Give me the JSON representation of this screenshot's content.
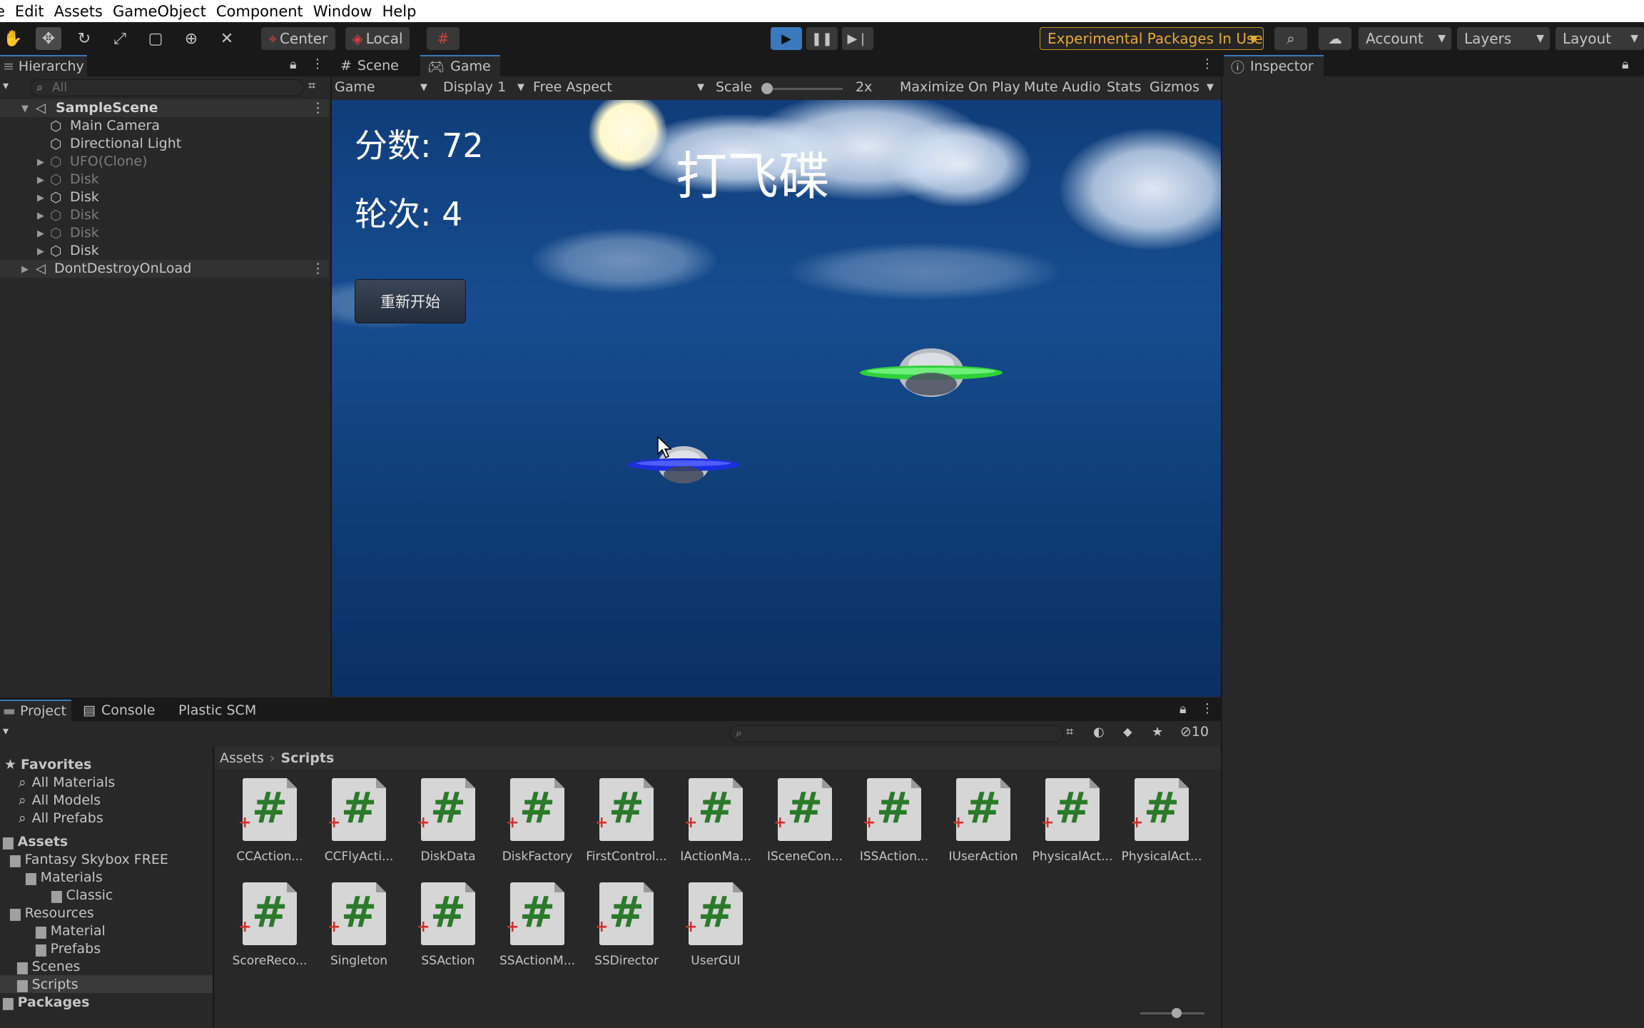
{
  "menu": [
    "e",
    "Edit",
    "Assets",
    "GameObject",
    "Component",
    "Window",
    "Help"
  ],
  "toolbar": {
    "pivot": "Center",
    "space": "Local",
    "experimental": "Experimental Packages In Use",
    "account": "Account",
    "layers": "Layers",
    "layout": "Layout"
  },
  "hierarchy": {
    "tab": "Hierarchy",
    "search_placeholder": "All",
    "scene": "SampleScene",
    "items": [
      {
        "label": "Main Camera",
        "active": true
      },
      {
        "label": "Directional Light",
        "active": true
      },
      {
        "label": "UFO(Clone)",
        "active": false
      },
      {
        "label": "Disk",
        "active": false
      },
      {
        "label": "Disk",
        "active": true
      },
      {
        "label": "Disk",
        "active": false
      },
      {
        "label": "Disk",
        "active": false
      },
      {
        "label": "Disk",
        "active": true
      }
    ],
    "dont_destroy": "DontDestroyOnLoad"
  },
  "view_tabs": {
    "scene": "Scene",
    "game": "Game"
  },
  "game_bar": {
    "mode": "Game",
    "display": "Display 1",
    "aspect": "Free Aspect",
    "scale_label": "Scale",
    "scale_value": "2x",
    "scale_fraction": 0.0,
    "maximize": "Maximize On Play",
    "mute": "Mute Audio",
    "stats": "Stats",
    "gizmos": "Gizmos"
  },
  "game": {
    "score": "分数: 72",
    "round": "轮次: 4",
    "title": "打飞碟",
    "restart": "重新开始"
  },
  "inspector": {
    "tab": "Inspector"
  },
  "bottom_tabs": {
    "project": "Project",
    "console": "Console",
    "plastic": "Plastic SCM"
  },
  "project": {
    "hidden_count": "10",
    "favorites": "Favorites",
    "fav_items": [
      "All Materials",
      "All Models",
      "All Prefabs"
    ],
    "assets": "Assets",
    "tree": [
      {
        "label": "Fantasy Skybox FREE",
        "depth": 1
      },
      {
        "label": "Materials",
        "depth": 2
      },
      {
        "label": "Classic",
        "depth": 3
      },
      {
        "label": "Resources",
        "depth": 1
      },
      {
        "label": "Material",
        "depth": 2
      },
      {
        "label": "Prefabs",
        "depth": 2
      },
      {
        "label": "Scenes",
        "depth": 1
      },
      {
        "label": "Scripts",
        "depth": 1
      }
    ],
    "packages": "Packages",
    "breadcrumb": {
      "root": "Assets",
      "current": "Scripts"
    },
    "scripts": [
      "CCAction...",
      "CCFlyActi...",
      "DiskData",
      "DiskFactory",
      "FirstControl...",
      "IActionMa...",
      "ISceneCon...",
      "ISSAction...",
      "IUserAction",
      "PhysicalAct...",
      "PhysicalAct...",
      "ScoreReco...",
      "Singleton",
      "SSAction",
      "SSActionM...",
      "SSDirector",
      "UserGUI"
    ]
  },
  "colors": {
    "accent": "#3a79bb",
    "play_active": "#3a79bb",
    "experimental_border": "#c9931e"
  }
}
